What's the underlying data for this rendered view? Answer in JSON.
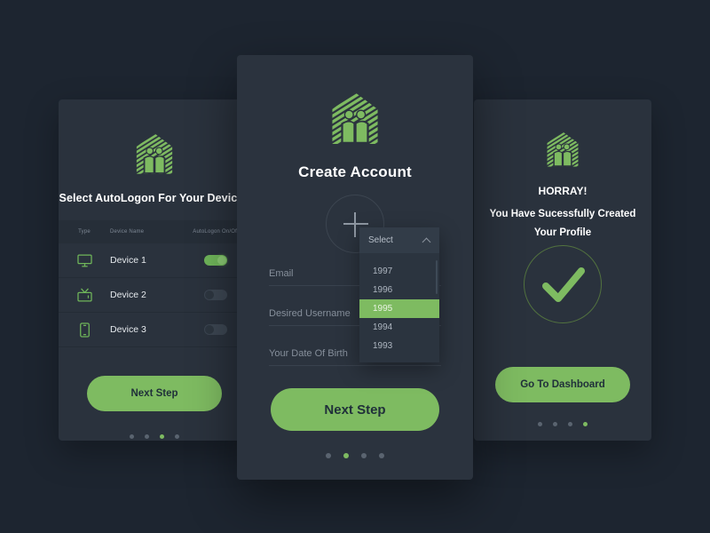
{
  "theme": {
    "background": "#1d2530",
    "card_bg": "#2a323d",
    "accent_green": "#7ebb61",
    "text_primary": "#ffffff",
    "text_muted": "#868f9b"
  },
  "screen_devices": {
    "logo_name": "house-people-logo",
    "title": "Select AutoLogon For Your Devices",
    "table": {
      "headers": [
        "Type",
        "Device Name",
        "AutoLogon On/Off"
      ],
      "rows": [
        {
          "icon": "monitor-icon",
          "name": "Device 1",
          "toggle": "on"
        },
        {
          "icon": "tv-icon",
          "name": "Device 2",
          "toggle": "off"
        },
        {
          "icon": "smartphone-icon",
          "name": "Device 3",
          "toggle": "off"
        }
      ]
    },
    "button_label": "Next Step",
    "dots": {
      "count": 4,
      "active_index": 2
    }
  },
  "screen_create": {
    "logo_name": "house-people-logo",
    "title": "Create Account",
    "avatar": {
      "name": "add-photo-avatar",
      "icon": "plus-icon"
    },
    "fields": [
      {
        "label": "Email",
        "value": "",
        "placeholder": "Email"
      },
      {
        "label": "Desired Username",
        "value": "",
        "placeholder": "Desired Username"
      },
      {
        "label": "Your Date Of Birth",
        "value": "",
        "placeholder": "Your Date Of Birth"
      }
    ],
    "dropdown": {
      "selected_label": "Select",
      "chevron": "chevron-up-icon",
      "options": [
        "1997",
        "1996",
        "1995",
        "1994",
        "1993"
      ],
      "highlighted": "1995"
    },
    "button_label": "Next Step",
    "dots": {
      "count": 4,
      "active_index": 1
    }
  },
  "screen_success": {
    "logo_name": "house-people-logo",
    "title": "HORRAY!",
    "subtitle_line1": "You Have Sucessfully Created",
    "subtitle_line2": "Your Profile",
    "check_icon": "check-circle-icon",
    "button_label": "Go To Dashboard",
    "dots": {
      "count": 4,
      "active_index": 3
    }
  }
}
